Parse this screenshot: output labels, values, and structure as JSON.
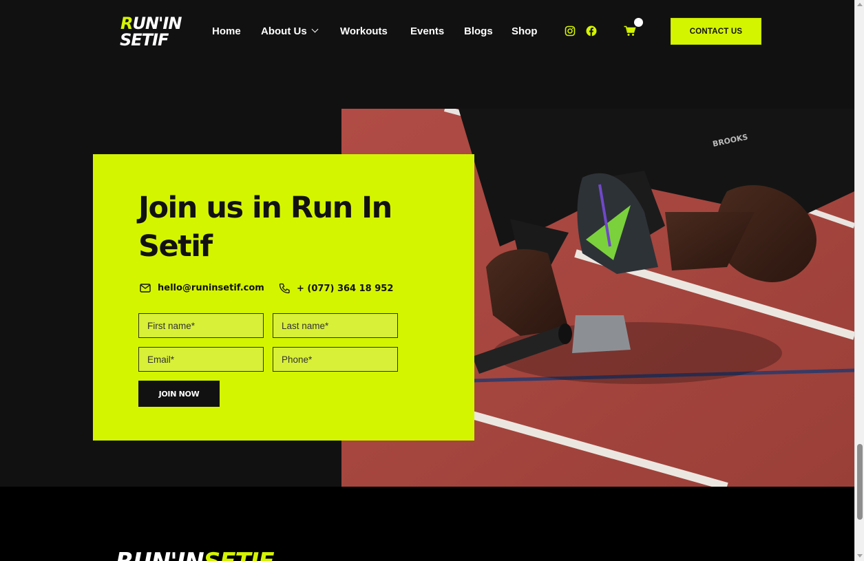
{
  "header": {
    "logo_line1_k": "R",
    "logo_line1_rest": "UN'IN",
    "logo_line2": "SETIF",
    "nav": [
      {
        "label": "Home"
      },
      {
        "label": "About Us"
      },
      {
        "label": "Workouts"
      },
      {
        "label": "Events"
      },
      {
        "label": "Blogs"
      },
      {
        "label": "Shop"
      }
    ],
    "social_icons": [
      "instagram-icon",
      "facebook-icon"
    ],
    "cart_icon": "cart-icon",
    "contact_label": "CONTACT US"
  },
  "hero": {
    "image_label": "sprinter-starting-block-photo"
  },
  "join_card": {
    "title": "Join us in Run In Setif",
    "email": "hello@runinsetif.com",
    "phone": "+ (077) 364 18 952",
    "fields": {
      "first_name_placeholder": "First name*",
      "last_name_placeholder": "Last name*",
      "email_placeholder": "Email*",
      "phone_placeholder": "Phone*"
    },
    "submit_label": "JOIN NOW"
  },
  "footer": {
    "logo_white": "RUN'IN",
    "logo_green": "SETIF"
  },
  "colors": {
    "accent": "#d4f500",
    "dark": "#121112",
    "footer": "#000000",
    "track": "#a8463f"
  }
}
